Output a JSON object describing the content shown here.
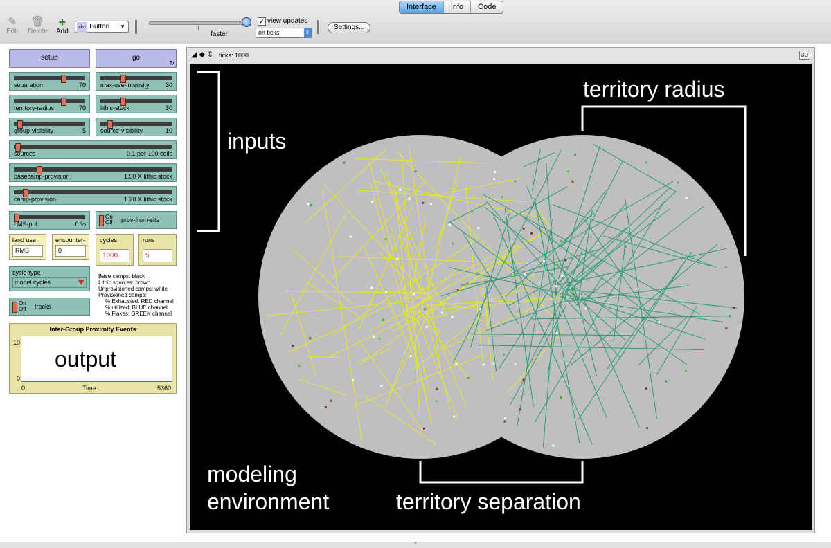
{
  "toolbar": {
    "tabs": [
      "Interface",
      "Info",
      "Code"
    ],
    "edit_label": "Edit",
    "delete_label": "Delete",
    "add_label": "Add",
    "widget_type": "Button",
    "widget_type_badge": "abc",
    "speed_label": "faster",
    "view_updates_label": "view updates",
    "view_updates_checked": true,
    "update_mode": "on ticks",
    "settings_label": "Settings..."
  },
  "widgets": {
    "setup_label": "setup",
    "go_label": "go",
    "sliders": [
      {
        "name": "separation",
        "value": "70",
        "fraction": 0.7
      },
      {
        "name": "max-use-intensity",
        "value": "30",
        "fraction": 0.3
      },
      {
        "name": "territory-radius",
        "value": "70",
        "fraction": 0.7
      },
      {
        "name": "lithic-stock",
        "value": "30",
        "fraction": 0.3
      },
      {
        "name": "group-visibility",
        "value": "5",
        "fraction": 0.05
      },
      {
        "name": "source-visibility",
        "value": "10",
        "fraction": 0.1
      },
      {
        "name": "sources",
        "value": "0.1 per 100 cells",
        "fraction": 0.01
      },
      {
        "name": "basecamp-provision",
        "value": "1.50 X lithic stock",
        "fraction": 0.15
      },
      {
        "name": "camp-provision",
        "value": "1.20 X lithic stock",
        "fraction": 0.06
      },
      {
        "name": "LMS-pct",
        "value": "0 %",
        "fraction": 0.0
      }
    ],
    "switch_on": "On",
    "switch_off": "Off",
    "prov_from_site_label": "prov-from-site",
    "tracks_label": "tracks",
    "land_use_label": "land use",
    "land_use_value": "RMS",
    "encounter_label": "encounter-",
    "encounter_value": "0",
    "cycles_label": "cycles",
    "cycles_value": "1000",
    "runs_label": "runs",
    "runs_value": "5",
    "cycle_type_label": "cycle-type",
    "cycle_type_value": "model cycles",
    "legend_notes": [
      "Base camps: black",
      "Lithic sources: brown",
      "Unprovisioned camps: white",
      "Provisioned camps:",
      "% Exhausted: RED channel",
      "% utilized: BLUE channel",
      "% Flakes: GREEN channel"
    ]
  },
  "plot": {
    "title": "Inter-Group Proximity Events",
    "y_max": "10",
    "y_min": "0",
    "x_min": "0",
    "x_label": "Time",
    "x_max": "5360",
    "overlay_label": "output"
  },
  "world": {
    "ticks_label": "ticks: 1000",
    "three_d_label": "3D"
  },
  "annotations": {
    "inputs": "inputs",
    "territory_radius": "territory radius",
    "modeling_environment_1": "modeling",
    "modeling_environment_2": "environment",
    "territory_separation": "territory separation"
  },
  "colors": {
    "button": "#babae8",
    "slider": "#8fc0b5",
    "world_bg": "#000000",
    "territory": "#bfbfbf",
    "yellow_group": "#e6e632",
    "green_group": "#2a9a78"
  }
}
